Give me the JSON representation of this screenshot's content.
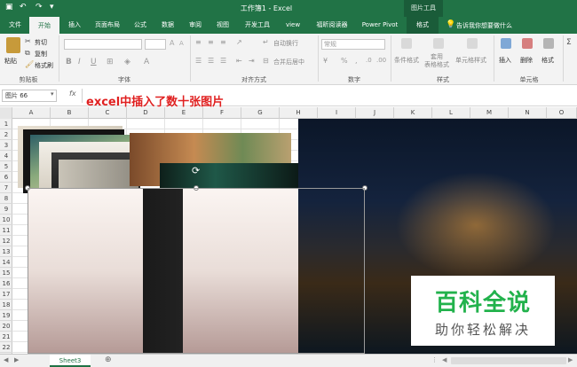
{
  "window": {
    "title": "工作簿1 - Excel",
    "context_tab": "图片工具"
  },
  "ribbon_tabs": [
    "文件",
    "开始",
    "插入",
    "页面布局",
    "公式",
    "数据",
    "审阅",
    "视图",
    "开发工具",
    "view",
    "福昕阅读器",
    "Power Pivot",
    "格式"
  ],
  "active_tab": "开始",
  "tell_me": "告诉我你想要做什么",
  "clipboard": {
    "paste": "粘贴",
    "cut": "剪切",
    "copy": "复制",
    "format_painter": "格式刷",
    "group": "剪贴板"
  },
  "font_group": {
    "bold": "B",
    "italic": "I",
    "underline": "U",
    "group": "字体"
  },
  "alignment_group": {
    "wrap": "自动换行",
    "merge": "合并后居中",
    "group": "对齐方式"
  },
  "number_group": {
    "format": "常规",
    "currency": "¥",
    "percent": "%",
    "group": "数字"
  },
  "styles_group": {
    "conditional": "条件格式",
    "table": "套用\n表格格式",
    "cell_styles": "单元格样式",
    "group": "样式"
  },
  "cells_group": {
    "insert": "插入",
    "delete": "删除",
    "format": "格式",
    "group": "单元格"
  },
  "formula_bar": {
    "name_box": "图片 66",
    "fx": "fx"
  },
  "annotation": "excel中插入了数十张图片",
  "columns": [
    "A",
    "B",
    "C",
    "D",
    "E",
    "F",
    "G",
    "H",
    "I",
    "J",
    "K",
    "L",
    "M",
    "N",
    "O"
  ],
  "rows": [
    "1",
    "2",
    "3",
    "4",
    "5",
    "6",
    "7",
    "8",
    "9",
    "10",
    "11",
    "12",
    "13",
    "14",
    "15",
    "16",
    "17",
    "18",
    "19",
    "20",
    "21",
    "22"
  ],
  "sheet_tab": "Sheet3",
  "watermark": {
    "title": "百科全说",
    "subtitle": "助你轻松解决"
  },
  "colors": {
    "excel_green": "#217346",
    "watermark_green": "#22b24c",
    "annotation_red": "#e02020"
  }
}
